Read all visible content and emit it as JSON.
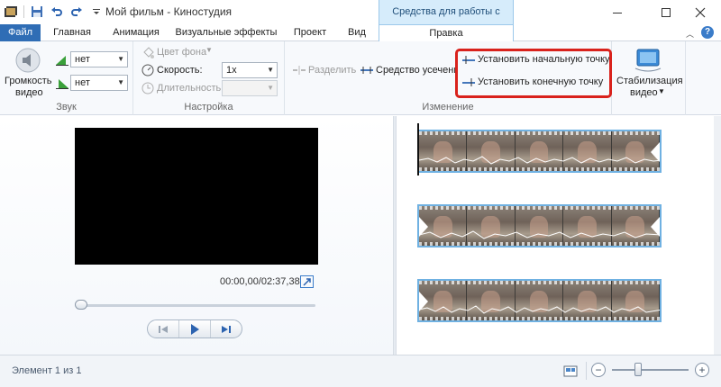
{
  "window": {
    "title": "Мой фильм - Киностудия",
    "context_tab_title": "Средства для работы с видео"
  },
  "tabs": [
    {
      "label": "Файл"
    },
    {
      "label": "Главная"
    },
    {
      "label": "Анимация"
    },
    {
      "label": "Визуальные эффекты"
    },
    {
      "label": "Проект"
    },
    {
      "label": "Вид"
    },
    {
      "label": "Правка"
    }
  ],
  "ribbon": {
    "sound": {
      "group_label": "Звук",
      "volume_label_1": "Громкость",
      "volume_label_2": "видео",
      "fade_in_value": "нет",
      "fade_out_value": "нет"
    },
    "settings": {
      "group_label": "Настройка",
      "bg_color_label": "Цвет фона",
      "speed_label": "Скорость:",
      "speed_value": "1x",
      "duration_label": "Длительность:"
    },
    "edit": {
      "group_label": "Изменение",
      "split_label": "Разделить",
      "trim_label": "Средство усечения",
      "set_start_label": "Установить начальную точку",
      "set_end_label": "Установить конечную точку"
    },
    "stabilization": {
      "label_1": "Стабилизация",
      "label_2": "видео"
    }
  },
  "player": {
    "timecode": "00:00,00/02:37,38"
  },
  "status": {
    "text": "Элемент 1 из 1"
  },
  "colors": {
    "file_tab": "#2f6db5",
    "highlight": "#d9221c",
    "clip_border": "#6fb1e2"
  }
}
